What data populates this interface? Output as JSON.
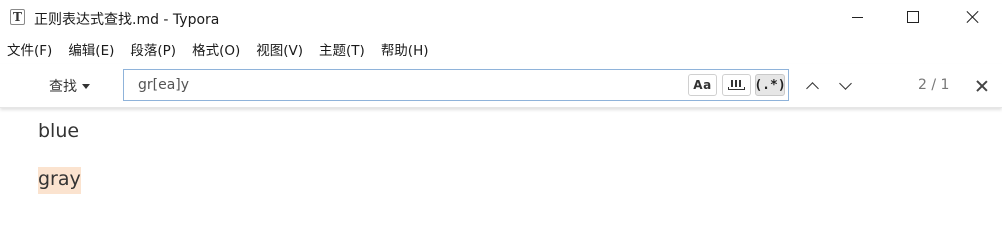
{
  "window": {
    "app_icon_letter": "T",
    "title": "正则表达式查找.md - Typora"
  },
  "menu": [
    "文件(F)",
    "编辑(E)",
    "段落(P)",
    "格式(O)",
    "视图(V)",
    "主题(T)",
    "帮助(H)"
  ],
  "findbar": {
    "mode_label": "查找",
    "query": "gr[ea]y",
    "case_label": "Aa",
    "regex_label": "(.*)",
    "regex_enabled": true,
    "match_count": "2 / 1"
  },
  "document": {
    "paragraphs": [
      "blue",
      "gray"
    ],
    "highlight_color": "#fbe3cf"
  }
}
